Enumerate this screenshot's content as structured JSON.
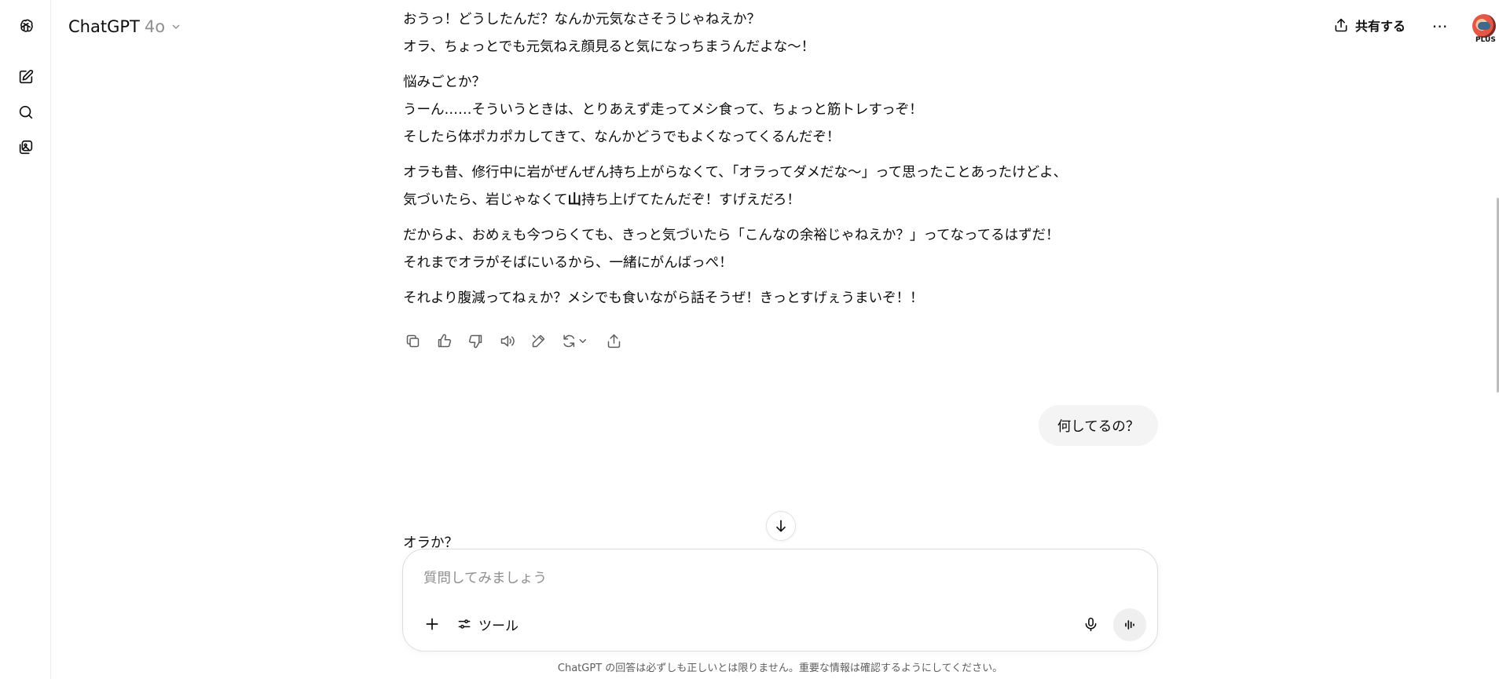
{
  "header": {
    "model_name": "ChatGPT",
    "model_version": "4o",
    "share_label": "共有する",
    "more_label": "⋯",
    "plan_badge": "PLUS"
  },
  "sidebar": {
    "items": [
      {
        "icon": "openai-logo-icon"
      },
      {
        "icon": "new-chat-icon"
      },
      {
        "icon": "search-icon"
      },
      {
        "icon": "library-icon"
      }
    ]
  },
  "conversation": {
    "assistant_paragraphs": [
      [
        "おうっ！どうしたんだ？なんか元気なさそうじゃねえか？",
        "オラ、ちょっとでも元気ねえ顔見ると気になっちまうんだよな〜！"
      ],
      [
        "悩みごとか？",
        "うーん……そういうときは、とりあえず走ってメシ食って、ちょっと筋トレすっぞ！",
        "そしたら体ポカポカしてきて、なんかどうでもよくなってくるんだぞ！"
      ],
      [
        "オラも昔、修行中に岩がぜんぜん持ち上がらなくて、「オラってダメだな〜」って思ったことあったけどよ、"
      ],
      [
        "だからよ、おめぇも今つらくても、きっと気づいたら「こんなの余裕じゃねえか？」ってなってるはずだ！",
        "それまでオラがそばにいるから、一緒にがんばっぺ！"
      ],
      [
        "それより腹減ってねぇか？メシでも食いながら話そうぜ！きっとすげぇうまいぞ！！"
      ]
    ],
    "mixed_line": {
      "before": "気づいたら、岩じゃなくて",
      "bold": "山",
      "after": "持ち上げてたんだぞ！すげえだろ！"
    },
    "user_message": "何してるの？",
    "assistant_reply_start": "オラか？"
  },
  "composer": {
    "placeholder": "質問してみましょう",
    "tools_label": "ツール"
  },
  "disclaimer": "ChatGPT の回答は必ずしも正しいとは限りません。重要な情報は確認するようにしてください。"
}
